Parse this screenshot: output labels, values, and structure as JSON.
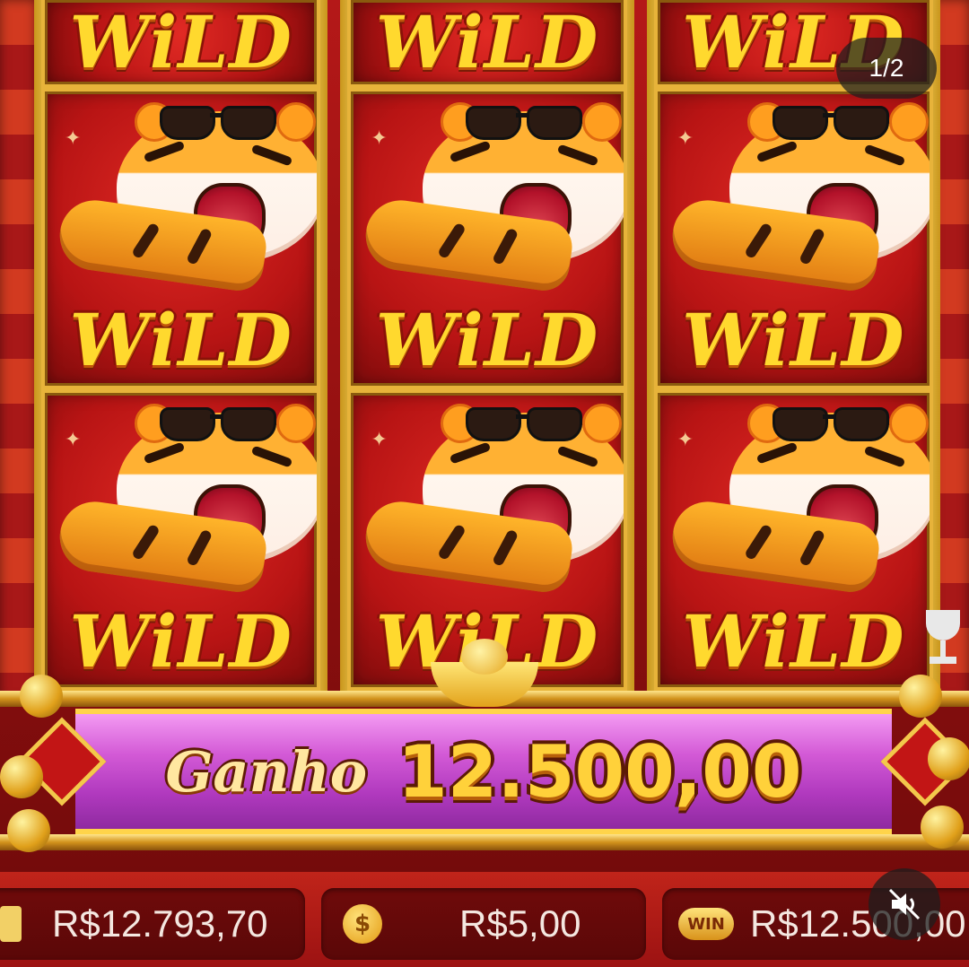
{
  "reels": [
    {
      "symbols": [
        "WiLD",
        "WiLD",
        "WiLD"
      ]
    },
    {
      "symbols": [
        "WiLD",
        "WiLD",
        "WiLD"
      ]
    },
    {
      "symbols": [
        "WiLD",
        "WiLD",
        "WiLD"
      ]
    }
  ],
  "page_indicator": "1/2",
  "win_banner": {
    "label": "Ganho",
    "amount": "12.500,00"
  },
  "status_bar": {
    "balance": "R$12.793,70",
    "bet": "R$5,00",
    "win_icon_text": "WIN",
    "bet_icon_text": "$",
    "win": "R$12.500,00"
  },
  "icons": {
    "balance": "wallet-icon",
    "bet": "coin-stack-icon",
    "win": "win-badge-icon",
    "mute": "speaker-muted-icon",
    "trophy": "trophy-icon"
  },
  "colors": {
    "banner": "#c44acb",
    "gold": "#ffd13a",
    "tile_red": "#c41616"
  }
}
